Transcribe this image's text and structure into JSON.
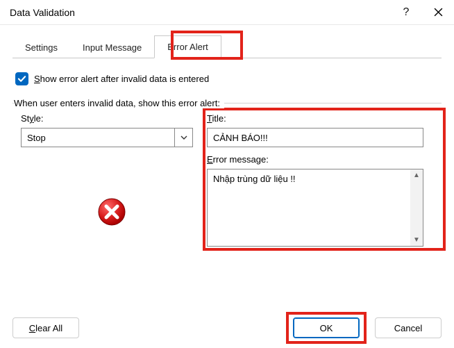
{
  "titlebar": {
    "title": "Data Validation",
    "help_label": "?",
    "close_label": "✕"
  },
  "tabs": {
    "settings": "Settings",
    "input_message": "Input Message",
    "error_alert": "Error Alert"
  },
  "checkbox": {
    "prefix": "S",
    "label_rest": "how error alert after invalid data is entered",
    "checked": true
  },
  "fieldset_label": "When user enters invalid data, show this error alert:",
  "style": {
    "prefix": "St",
    "u": "y",
    "suffix": "le:",
    "value": "Stop"
  },
  "title_field": {
    "u": "T",
    "rest": "itle:",
    "value": "CẢNH BÁO!!!"
  },
  "error_msg": {
    "u": "E",
    "rest": "rror message:",
    "value": "Nhập trùng dữ liệu !!"
  },
  "buttons": {
    "clear_u": "C",
    "clear_rest": "lear All",
    "ok": "OK",
    "cancel": "Cancel"
  }
}
